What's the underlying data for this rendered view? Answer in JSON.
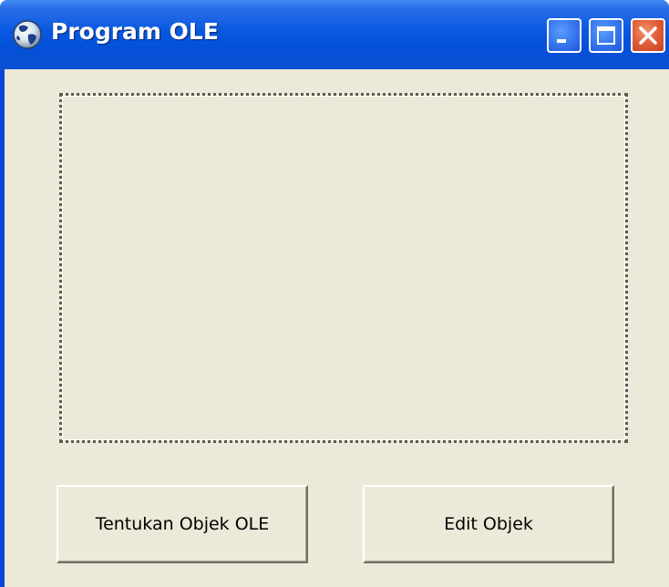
{
  "window": {
    "title": "Program OLE",
    "icon": "globe-icon",
    "controls": [
      "minimize-icon",
      "maximize-icon",
      "close-icon"
    ]
  },
  "form": {
    "ole_container": "ole-container-frame",
    "buttons": {
      "insert_object_label": "Tentukan Objek OLE",
      "edit_object_label": "Edit Objek"
    }
  },
  "colors": {
    "titlebar": "#0858e0",
    "client_background": "#ece9d8",
    "close_button": "#e3603c",
    "window_button": "#3a7cf0"
  }
}
